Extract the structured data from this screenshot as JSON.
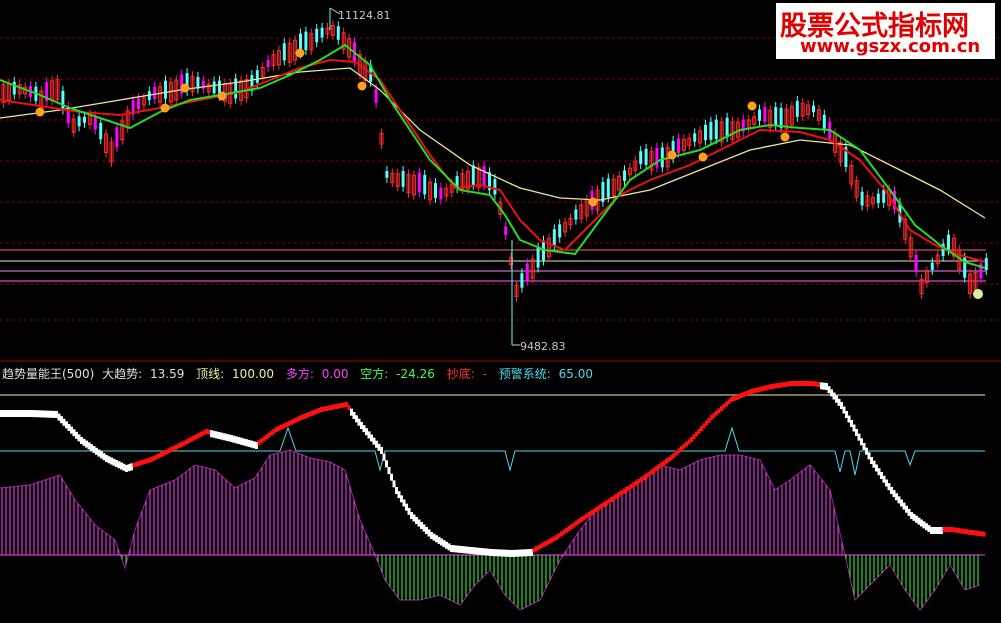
{
  "watermark": {
    "line1": "股票公式指标网",
    "line2": "www.gszx.com.cn"
  },
  "price_panel": {
    "high_label": "11124.81",
    "low_label": "9482.83"
  },
  "indicator_header": {
    "name": "趋势量能王(500)",
    "trend_label": "大趋势:",
    "trend_value": "13.59",
    "top_label": "顶线:",
    "top_value": "100.00",
    "long_label": "多方:",
    "long_value": "0.00",
    "short_label": "空方:",
    "short_value": "-24.26",
    "bottom_label": "抄底:",
    "bottom_value": "-",
    "alert_label": "预警系统:",
    "alert_value": "65.00"
  },
  "colors": {
    "up_candle": "#ff2a2a",
    "down_candle": "#54ffff",
    "bear_candle_fill": "#ff00ff",
    "ma_green": "#22dd22",
    "ma_red": "#ee1111",
    "ma_yellow": "#e8e8a0",
    "grid": "#8a0000",
    "trend_white": "#ffffff",
    "trend_red": "#ff1010",
    "alert_cyan": "#4fd8e8",
    "top_line": "#f0f0a0",
    "vol_magenta": "#ff40ff",
    "vol_green": "#40ff40"
  }
}
